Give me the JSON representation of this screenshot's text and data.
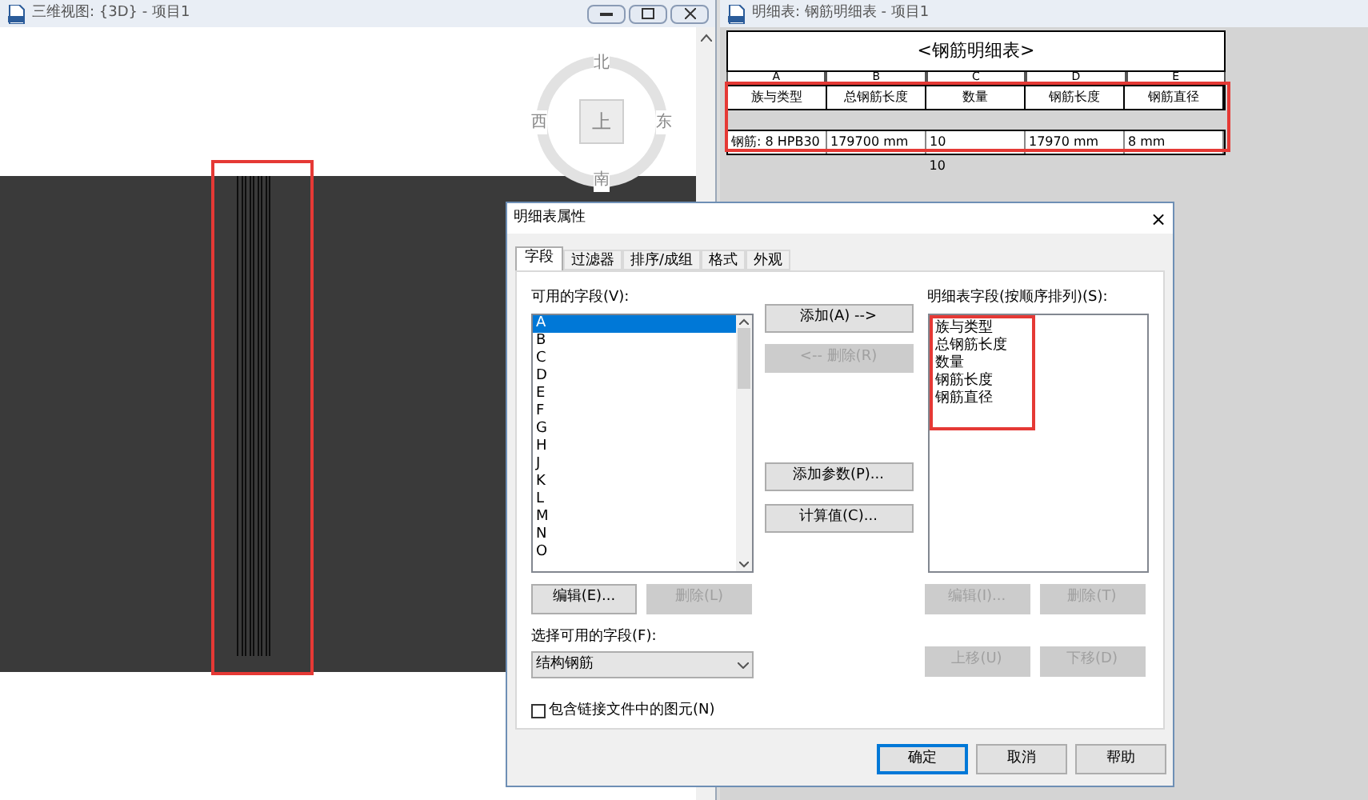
{
  "view_window": {
    "title": "三维视图: {3D} - 项目1",
    "viewcube": {
      "top": "上",
      "north": "北",
      "south": "南",
      "east": "东",
      "west": "西"
    }
  },
  "schedule_window": {
    "title": "明细表: 钢筋明细表 - 项目1",
    "table": {
      "title": "<钢筋明细表>",
      "column_letters": [
        "A",
        "B",
        "C",
        "D",
        "E"
      ],
      "headers": [
        "族与类型",
        "总钢筋长度",
        "数量",
        "钢筋长度",
        "钢筋直径"
      ],
      "rows": [
        [
          "钢筋: 8 HPB30",
          "179700 mm",
          "10",
          "17970 mm",
          "8 mm"
        ]
      ],
      "total": "10"
    }
  },
  "dialog": {
    "title": "明细表属性",
    "close": "×",
    "tabs": [
      {
        "label": "字段",
        "selected": true
      },
      {
        "label": "过滤器",
        "selected": false
      },
      {
        "label": "排序/成组",
        "selected": false
      },
      {
        "label": "格式",
        "selected": false
      },
      {
        "label": "外观",
        "selected": false
      }
    ],
    "available_label": "可用的字段(V):",
    "available_fields": [
      {
        "label": "A",
        "selected": true
      },
      {
        "label": "B",
        "selected": false
      },
      {
        "label": "C",
        "selected": false
      },
      {
        "label": "D",
        "selected": false
      },
      {
        "label": "E",
        "selected": false
      },
      {
        "label": "F",
        "selected": false
      },
      {
        "label": "G",
        "selected": false
      },
      {
        "label": "H",
        "selected": false
      },
      {
        "label": "J",
        "selected": false
      },
      {
        "label": "K",
        "selected": false
      },
      {
        "label": "L",
        "selected": false
      },
      {
        "label": "M",
        "selected": false
      },
      {
        "label": "N",
        "selected": false
      },
      {
        "label": "O",
        "selected": false
      }
    ],
    "middle_buttons": [
      {
        "label": "添加(A) -->",
        "disabled": false
      },
      {
        "label": "<-- 删除(R)",
        "disabled": true
      },
      {
        "label": "添加参数(P)...",
        "disabled": false
      },
      {
        "label": "计算值(C)...",
        "disabled": false
      }
    ],
    "schedule_label": "明细表字段(按顺序排列)(S):",
    "schedule_fields": [
      "族与类型",
      "总钢筋长度",
      "数量",
      "钢筋长度",
      "钢筋直径"
    ],
    "left_buttons": [
      {
        "label": "编辑(E)...",
        "disabled": false
      },
      {
        "label": "删除(L)",
        "disabled": true
      }
    ],
    "right_buttons": [
      {
        "label": "编辑(I)...",
        "disabled": true
      },
      {
        "label": "删除(T)",
        "disabled": true
      }
    ],
    "move_buttons": [
      {
        "label": "上移(U)",
        "disabled": true
      },
      {
        "label": "下移(D)",
        "disabled": true
      }
    ],
    "select_label": "选择可用的字段(F):",
    "select_value": "结构钢筋",
    "include_linked": {
      "label": "包含链接文件中的图元(N)",
      "checked": false
    },
    "footer_buttons": [
      {
        "label": "确定",
        "default": true
      },
      {
        "label": "取消",
        "default": false
      },
      {
        "label": "帮助",
        "default": false
      }
    ]
  }
}
